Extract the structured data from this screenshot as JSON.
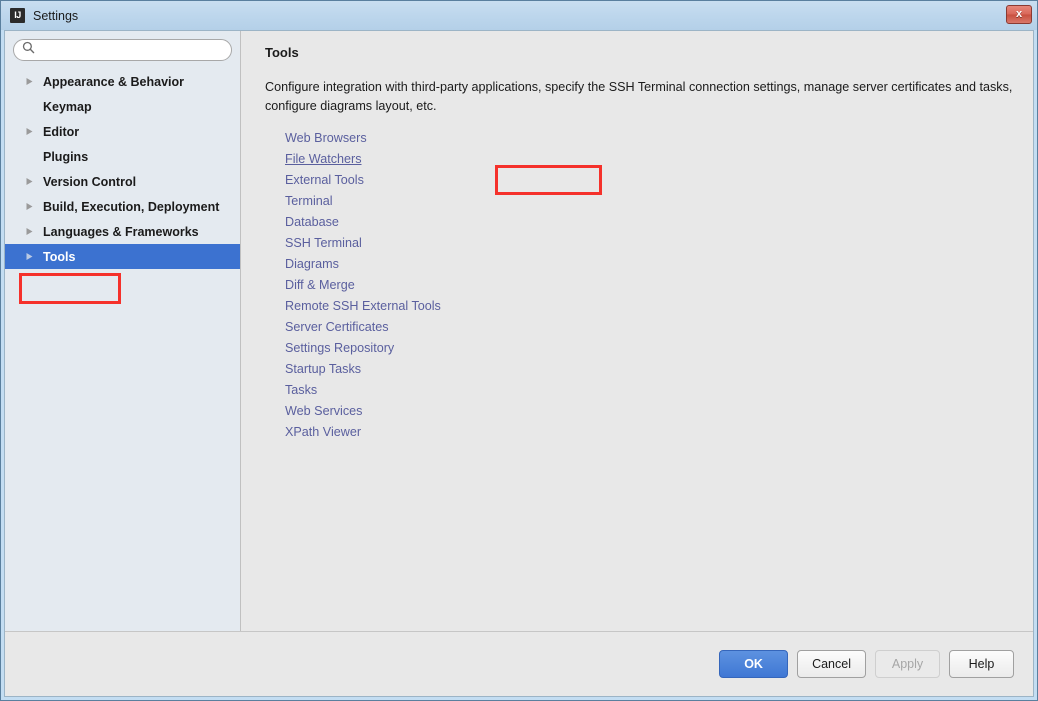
{
  "window": {
    "title": "Settings",
    "app_icon": "ij-logo-icon",
    "close_label": "x"
  },
  "sidebar": {
    "search": {
      "value": "",
      "placeholder": "",
      "icon": "search-icon"
    },
    "items": [
      {
        "label": "Appearance & Behavior",
        "expandable": true,
        "selected": false
      },
      {
        "label": "Keymap",
        "expandable": false,
        "selected": false
      },
      {
        "label": "Editor",
        "expandable": true,
        "selected": false
      },
      {
        "label": "Plugins",
        "expandable": false,
        "selected": false
      },
      {
        "label": "Version Control",
        "expandable": true,
        "selected": false
      },
      {
        "label": "Build, Execution, Deployment",
        "expandable": true,
        "selected": false
      },
      {
        "label": "Languages & Frameworks",
        "expandable": true,
        "selected": false
      },
      {
        "label": "Tools",
        "expandable": true,
        "selected": true
      }
    ]
  },
  "content": {
    "title": "Tools",
    "description": "Configure integration with third-party applications, specify the SSH Terminal connection settings, manage server certificates and tasks, configure diagrams layout, etc.",
    "links": [
      {
        "label": "Web Browsers",
        "hovered": false
      },
      {
        "label": "File Watchers",
        "hovered": true
      },
      {
        "label": "External Tools",
        "hovered": false
      },
      {
        "label": "Terminal",
        "hovered": false
      },
      {
        "label": "Database",
        "hovered": false
      },
      {
        "label": "SSH Terminal",
        "hovered": false
      },
      {
        "label": "Diagrams",
        "hovered": false
      },
      {
        "label": "Diff & Merge",
        "hovered": false
      },
      {
        "label": "Remote SSH External Tools",
        "hovered": false
      },
      {
        "label": "Server Certificates",
        "hovered": false
      },
      {
        "label": "Settings Repository",
        "hovered": false
      },
      {
        "label": "Startup Tasks",
        "hovered": false
      },
      {
        "label": "Tasks",
        "hovered": false
      },
      {
        "label": "Web Services",
        "hovered": false
      },
      {
        "label": "XPath Viewer",
        "hovered": false
      }
    ]
  },
  "footer": {
    "ok_label": "OK",
    "cancel_label": "Cancel",
    "apply_label": "Apply",
    "help_label": "Help"
  },
  "annotations": {
    "tools_box_label": "",
    "file_watchers_box_label": ""
  },
  "colors": {
    "selection_blue": "#3c72d0",
    "annotation_red": "#f5312b",
    "link_color": "#5a5f9e",
    "titlebar_blue": "#b4d0e8",
    "close_red": "#d9675a"
  }
}
